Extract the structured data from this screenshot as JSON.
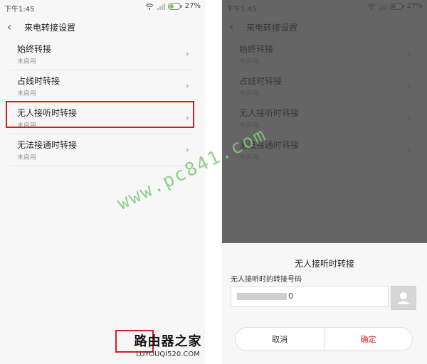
{
  "status": {
    "time": "下午1:45",
    "battery": "27%",
    "wifi_icon": "wifi-icon",
    "signal_icon": "signal-icon",
    "battery_icon": "battery-icon"
  },
  "header": {
    "title": "来电转接设置",
    "back_icon": "back-arrow-icon"
  },
  "items": [
    {
      "label": "始终转接",
      "status": "未启用"
    },
    {
      "label": "占线时转接",
      "status": "未启用"
    },
    {
      "label": "无人接听时转接",
      "status": "未启用"
    },
    {
      "label": "无法接通时转接",
      "status": "未启用"
    }
  ],
  "watermark": "www.pc841.com",
  "dialog": {
    "title": "无人接听时转接",
    "label": "无人接听时的转接号码",
    "number_suffix": "0",
    "cancel": "取消",
    "ok": "确定",
    "contact_icon": "contact-avatar-icon"
  },
  "brand": {
    "name": "路由器之家",
    "url": "LUYOUQI520.COM"
  },
  "colors": {
    "highlight": "#d32020",
    "battery_accent": "#7ac943",
    "watermark": "#7ec97c"
  }
}
